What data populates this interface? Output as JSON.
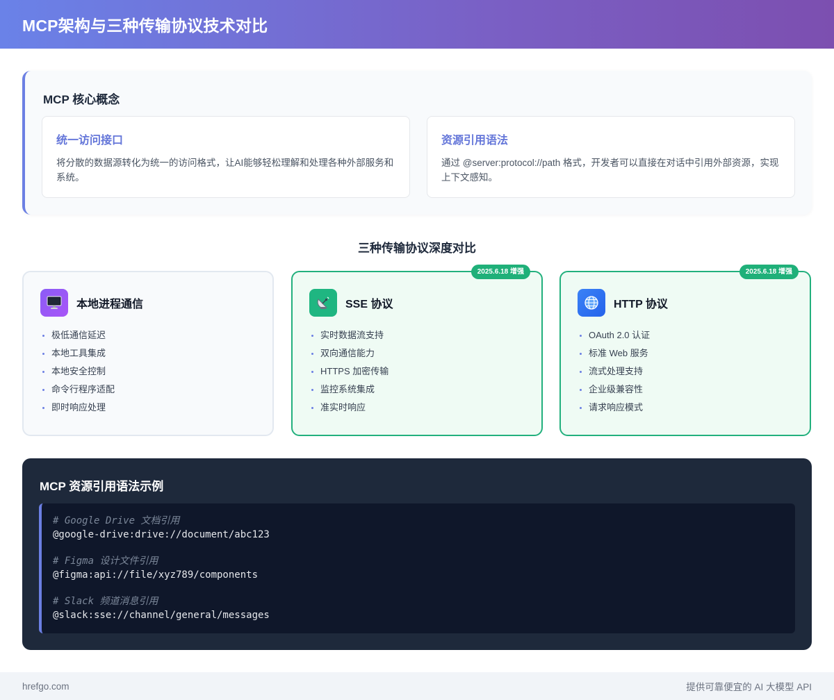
{
  "header": {
    "title": "MCP架构与三种传输协议技术对比"
  },
  "concept": {
    "title": "MCP 核心概念",
    "cards": [
      {
        "title": "统一访问接口",
        "text": "将分散的数据源转化为统一的访问格式，让AI能够轻松理解和处理各种外部服务和系统。"
      },
      {
        "title": "资源引用语法",
        "text": "通过 @server:protocol://path 格式，开发者可以直接在对话中引用外部资源，实现上下文感知。"
      }
    ]
  },
  "comparison": {
    "title": "三种传输协议深度对比",
    "protocols": [
      {
        "name": "本地进程通信",
        "icon": "computer-icon",
        "badge": "",
        "features": [
          "极低通信延迟",
          "本地工具集成",
          "本地安全控制",
          "命令行程序适配",
          "即时响应处理"
        ]
      },
      {
        "name": "SSE 协议",
        "icon": "satellite-icon",
        "badge": "2025.6.18 增强",
        "features": [
          "实时数据流支持",
          "双向通信能力",
          "HTTPS 加密传输",
          "监控系统集成",
          "准实时响应"
        ]
      },
      {
        "name": "HTTP 协议",
        "icon": "globe-icon",
        "badge": "2025.6.18 增强",
        "features": [
          "OAuth 2.0 认证",
          "标准 Web 服务",
          "流式处理支持",
          "企业级兼容性",
          "请求响应模式"
        ]
      }
    ]
  },
  "code": {
    "title": "MCP 资源引用语法示例",
    "blocks": [
      {
        "comment": "# Google Drive 文档引用",
        "line": "@google-drive:drive://document/abc123"
      },
      {
        "comment": "# Figma 设计文件引用",
        "line": "@figma:api://file/xyz789/components"
      },
      {
        "comment": "# Slack 频道消息引用",
        "line": "@slack:sse://channel/general/messages"
      }
    ]
  },
  "footer": {
    "left": "hrefgo.com",
    "right": "提供可靠便宜的 AI 大模型 API"
  },
  "colors": {
    "accent": "#6b7fe3",
    "green": "#22b07d",
    "dark_panel": "#1e293b",
    "code_bg": "#0f172a"
  }
}
